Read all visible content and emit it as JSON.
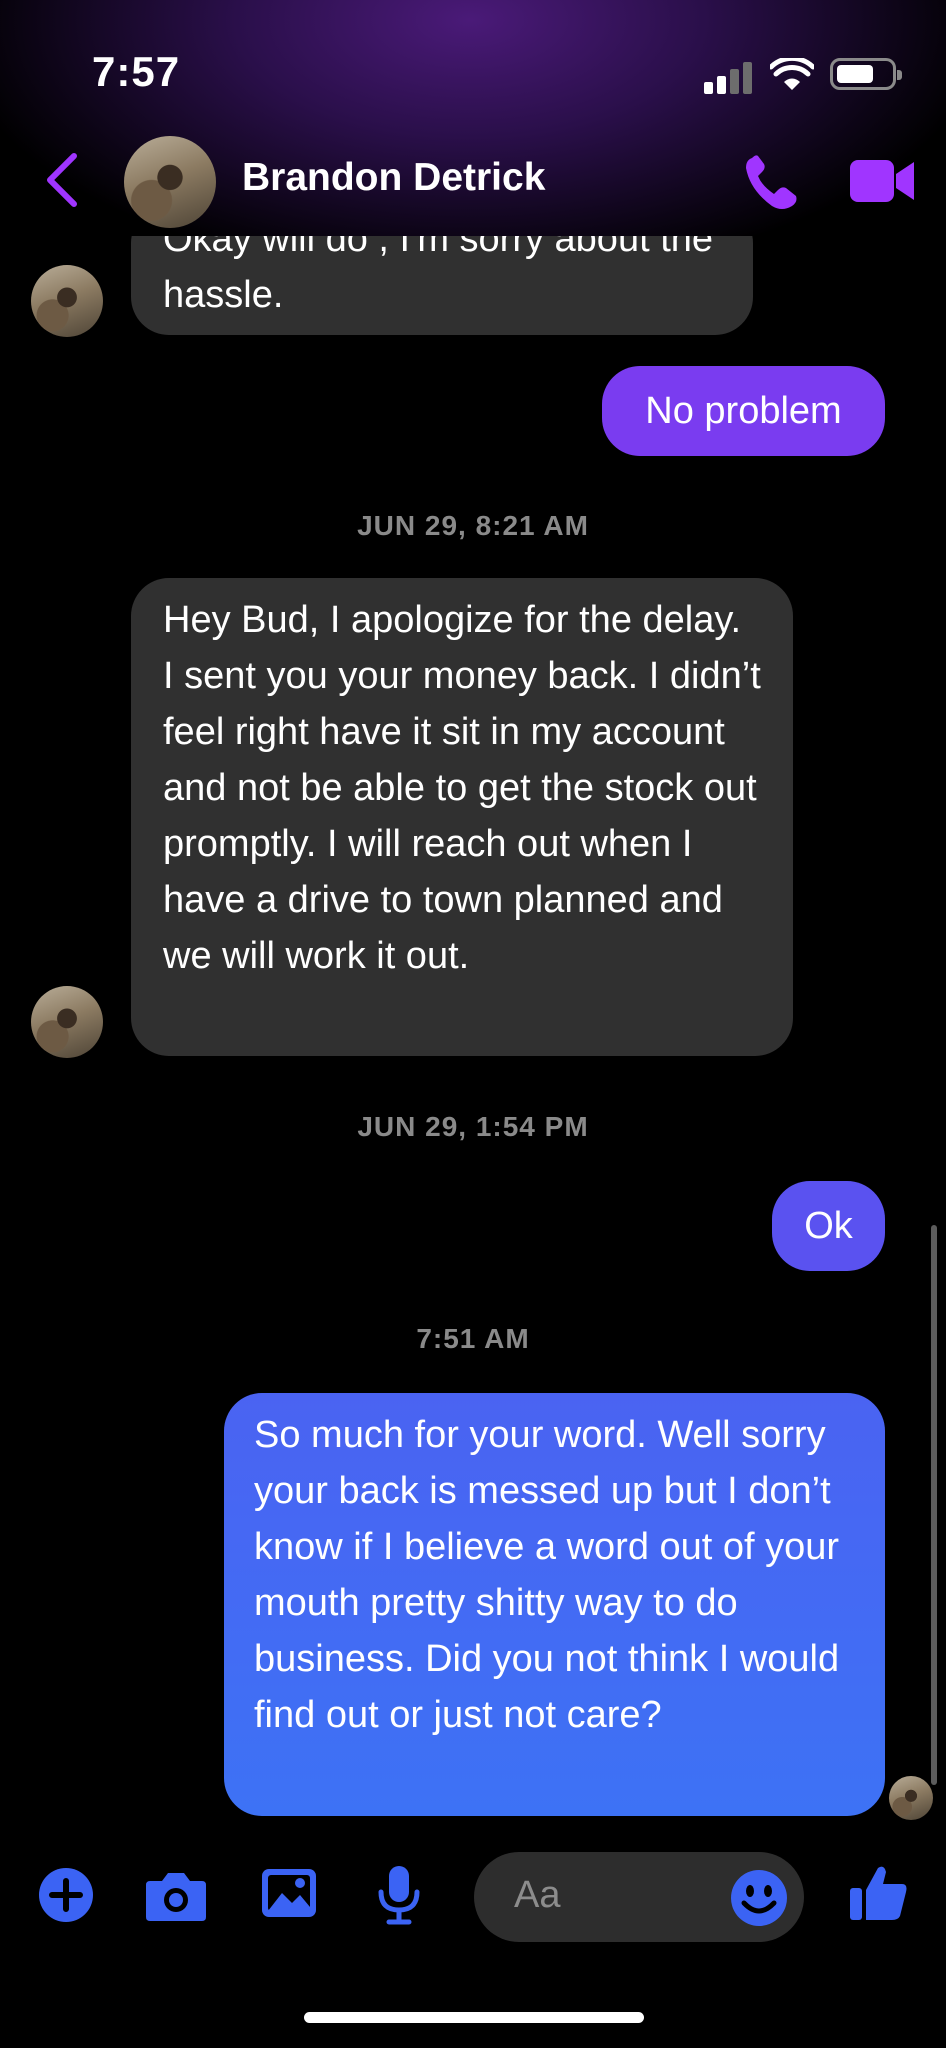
{
  "status": {
    "time": "7:57"
  },
  "header": {
    "contact_name": "Brandon Detrick",
    "icons": [
      "back-chevron-icon",
      "phone-icon",
      "video-camera-icon"
    ]
  },
  "colors": {
    "accent": "#a035ff",
    "outgoing_purple": "#7a3cf0",
    "outgoing_blue": "#4a63f2",
    "incoming": "#303030"
  },
  "messages": [
    {
      "direction": "in",
      "text": "Okay will do , I'm sorry about the hassle."
    },
    {
      "direction": "out",
      "text": "No problem"
    },
    {
      "direction": "timestamp",
      "text": "JUN 29, 8:21 AM"
    },
    {
      "direction": "in",
      "text": "Hey Bud, I apologize for the delay. I sent you your money back. I didn’t feel right have it sit in my account and not be able to get the stock out promptly. I will reach out when I have a drive to town planned and we will work it out."
    },
    {
      "direction": "timestamp",
      "text": "JUN 29, 1:54 PM"
    },
    {
      "direction": "out",
      "text": "Ok"
    },
    {
      "direction": "timestamp",
      "text": "7:51 AM"
    },
    {
      "direction": "out",
      "text": "So much for your word. Well sorry your back is messed up but I don’t know if I believe a word out of your mouth pretty shitty way to do business. Did you not think I would find out or just not care?"
    }
  ],
  "composer": {
    "placeholder": "Aa",
    "icons": [
      "plus-icon",
      "camera-icon",
      "image-icon",
      "microphone-icon",
      "emoji-icon",
      "thumbs-up-icon"
    ]
  }
}
